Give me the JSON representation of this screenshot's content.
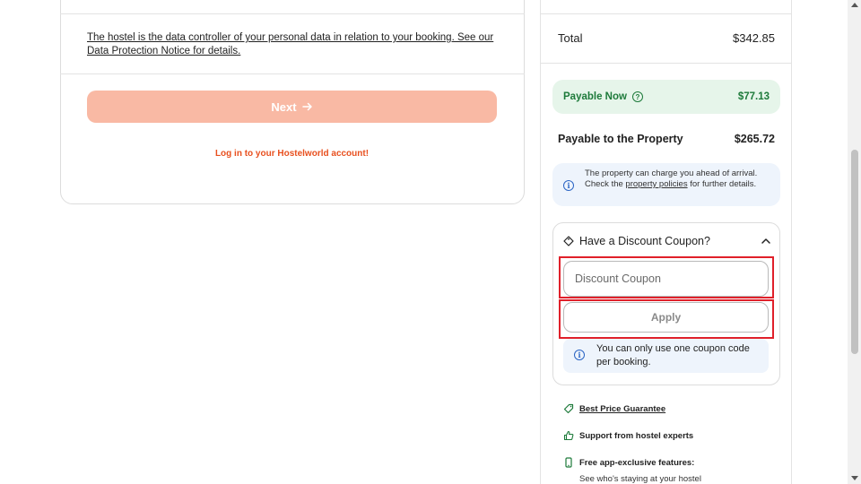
{
  "left": {
    "notice": "The hostel is the data controller of your personal data in relation to your booking. See our Data Protection Notice for details.",
    "next_label": "Next",
    "login_link": "Log in to your Hostelworld account!"
  },
  "summary": {
    "total_label": "Total",
    "total_value": "$342.85",
    "payable_now_label": "Payable Now",
    "payable_now_value": "$77.13",
    "payable_property_label": "Payable to the Property",
    "payable_property_value": "$265.72",
    "charge_info_prefix": "The property can charge you ahead of arrival. Check the",
    "charge_info_link": "property policies",
    "charge_info_suffix": "for further details."
  },
  "coupon": {
    "header": "Have a Discount Coupon?",
    "input_placeholder": "Discount Coupon",
    "input_value": "",
    "apply_label": "Apply",
    "note": "You can only use one coupon code per booking."
  },
  "features": {
    "best_price": "Best Price Guarantee",
    "support": "Support from hostel experts",
    "app_features": "Free app-exclusive features:",
    "app_features_sub": "See who's staying at your hostel"
  },
  "colors": {
    "accent": "#e8501f",
    "next_button": "#f9b9a4",
    "payable_now_bg": "#e6f5ea",
    "payable_now_text": "#1d7a3a",
    "info_bg": "#eef4fc",
    "highlight_border": "#e0202a"
  },
  "icons": {
    "next_arrow": "arrow-right-icon",
    "help": "help-circle-icon",
    "info": "info-icon",
    "tag": "tag-icon",
    "collapse": "chevron-up-icon",
    "best_price": "price-tag-icon",
    "support": "thumbs-up-icon",
    "app": "smartphone-icon"
  }
}
